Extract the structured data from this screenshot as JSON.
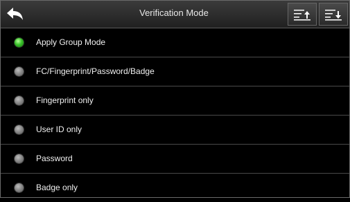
{
  "header": {
    "title": "Verification Mode",
    "back_icon": "back-arrow-icon",
    "sort_ascending_icon": "sort-ascending-icon",
    "sort_descending_icon": "sort-descending-icon"
  },
  "options": [
    {
      "label": "Apply Group Mode",
      "selected": true
    },
    {
      "label": "FC/Fingerprint/Password/Badge",
      "selected": false
    },
    {
      "label": "Fingerprint only",
      "selected": false
    },
    {
      "label": "User ID only",
      "selected": false
    },
    {
      "label": "Password",
      "selected": false
    },
    {
      "label": "Badge only",
      "selected": false
    }
  ],
  "colors": {
    "selected_radio": "#39c22a",
    "unselected_radio": "#8a8a8a",
    "background": "#000000"
  }
}
